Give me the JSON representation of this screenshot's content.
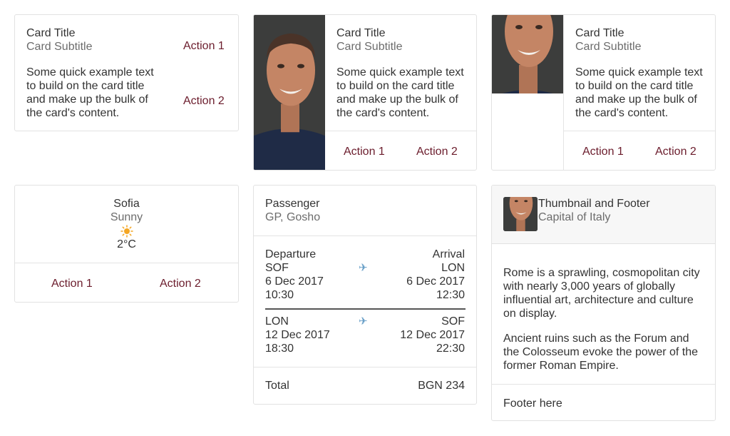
{
  "card1": {
    "title": "Card Title",
    "subtitle": "Card Subtitle",
    "text": "Some quick example text to build on the card title and make up the bulk of the card's content.",
    "action1": "Action 1",
    "action2": "Action 2"
  },
  "card2": {
    "title": "Card Title",
    "subtitle": "Card Subtitle",
    "text": "Some quick example text to build on the card title and make up the bulk of the card's content.",
    "action1": "Action 1",
    "action2": "Action 2"
  },
  "card3": {
    "title": "Card Title",
    "subtitle": "Card Subtitle",
    "text": "Some quick example text to build on the card title and make up the bulk of the card's content.",
    "action1": "Action 1",
    "action2": "Action 2"
  },
  "weather": {
    "city": "Sofia",
    "condition": "Sunny",
    "icon": "sun-icon",
    "temperature": "2°C",
    "action1": "Action 1",
    "action2": "Action 2"
  },
  "flight": {
    "passenger_label": "Passenger",
    "passenger_name": "GP, Gosho",
    "departure_label": "Departure",
    "arrival_label": "Arrival",
    "leg1": {
      "from": "SOF",
      "from_date": "6 Dec 2017",
      "from_time": "10:30",
      "to": "LON",
      "to_date": "6 Dec 2017",
      "to_time": "12:30"
    },
    "leg2": {
      "from": "LON",
      "from_date": "12 Dec 2017",
      "from_time": "18:30",
      "to": "SOF",
      "to_date": "12 Dec 2017",
      "to_time": "22:30"
    },
    "total_label": "Total",
    "total_value": "BGN 234"
  },
  "thumb": {
    "title": "Thumbnail and Footer",
    "subtitle": "Capital of Italy",
    "para1": "Rome is a sprawling, cosmopolitan city with nearly 3,000 years of globally influential art, architecture and culture on display.",
    "para2": "Ancient ruins such as the Forum and the Colosseum evoke the power of the former Roman Empire.",
    "footer": "Footer here"
  },
  "colors": {
    "accent": "#6b1c2c",
    "border": "#e2e2e2",
    "subtitle": "#6c6c6c",
    "sun": "#f4a623",
    "header_bg": "#f7f7f7"
  }
}
